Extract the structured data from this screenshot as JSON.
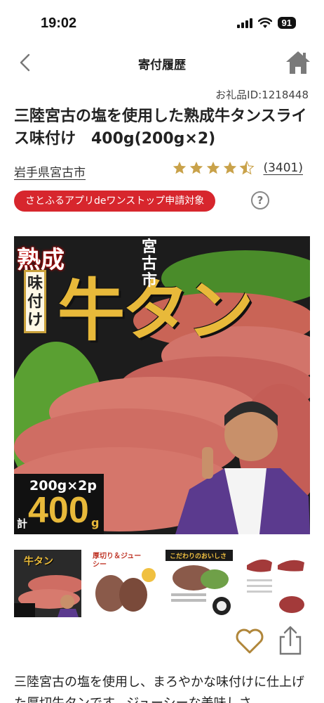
{
  "status_bar": {
    "time": "19:02",
    "battery": "91"
  },
  "nav": {
    "title": "寄付履歴",
    "back_icon": "chevron-left-icon",
    "home_icon": "home-icon"
  },
  "product": {
    "item_id": "お礼品ID:1218448",
    "title": "三陸宮古の塩を使用した熟成牛タンスライス味付け　400g(200g×2)",
    "municipality": "岩手県宮古市",
    "rating": 4.5,
    "review_count": "(3401)",
    "badge": "さとふるアプリdeワンストップ申請対象",
    "help": "?"
  },
  "hero": {
    "jukusei": "熟成",
    "ajitsuke": "味付け",
    "gyutan": "牛タン",
    "city": "宮古市",
    "weight_small": "200g×2p",
    "kei": "計",
    "weight_big": "400",
    "unit": "g"
  },
  "thumbnails": [
    {
      "label": "牛タン",
      "active": true
    },
    {
      "label": "厚切り＆ジューシー",
      "active": false
    },
    {
      "label": "こだわりのおいしさ",
      "active": false
    },
    {
      "label": "",
      "active": false
    }
  ],
  "actions": {
    "favorite_icon": "heart-icon",
    "share_icon": "share-icon"
  },
  "description": "三陸宮古の塩を使用し、まろやかな味付けに仕上げた厚切牛タンです。ジューシーな美味しさ",
  "colors": {
    "accent_red": "#d7262d",
    "star": "#c9a24a",
    "heart": "#b0863a",
    "nav_icon": "#7a7a7a"
  }
}
